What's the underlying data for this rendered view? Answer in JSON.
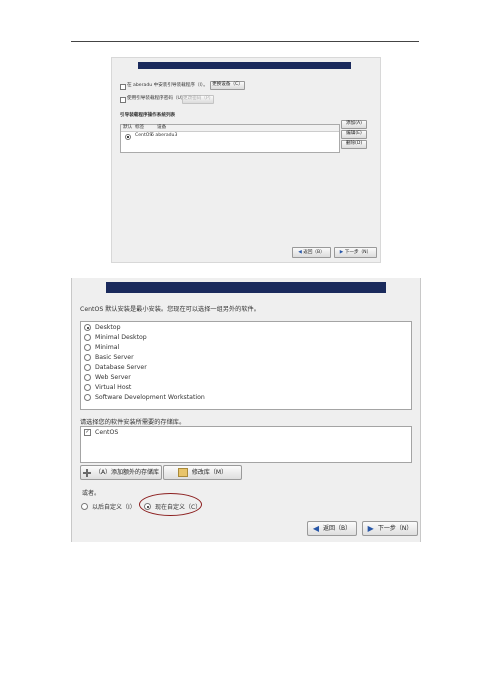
{
  "shot1": {
    "checkbox_label": "在 aberadu 中安装引导装载程序（I）。",
    "change_device_button": "更换设备（C）",
    "password_checkbox_label": "使用引导装载程序密码（U）",
    "change_password_button": "更改密码（P）",
    "os_list_label": "引导装载程序操作系统列表",
    "table_headers": [
      "默认",
      "标签",
      "设备"
    ],
    "table_row": {
      "label": "CentOS",
      "device": "6 aberadu3"
    },
    "add_button": "添加(A)",
    "edit_button": "编辑(E)",
    "delete_button": "删除(D)",
    "back_button": "返回（B）",
    "next_button": "下一步（N）"
  },
  "shot2": {
    "intro": "CentOS 默认安装是最小安装。您现在可以选择一组另外的软件。",
    "options": [
      {
        "label": "Desktop",
        "selected": true
      },
      {
        "label": "Minimal Desktop",
        "selected": false
      },
      {
        "label": "Minimal",
        "selected": false
      },
      {
        "label": "Basic Server",
        "selected": false
      },
      {
        "label": "Database Server",
        "selected": false
      },
      {
        "label": "Web Server",
        "selected": false
      },
      {
        "label": "Virtual Host",
        "selected": false
      },
      {
        "label": "Software Development Workstation",
        "selected": false
      }
    ],
    "repo_label": "请选择您的软件安装所需要的存储库。",
    "repo_item": "CentOS",
    "add_repo_button": "（A）添加额外的存储库",
    "modify_repo_button": "修改库（M）",
    "or_label": "或者。",
    "customize_later": "以后自定义（I）",
    "customize_now": "现在自定义（C）",
    "back_button": "返回（B）",
    "next_button": "下一步（N）"
  }
}
